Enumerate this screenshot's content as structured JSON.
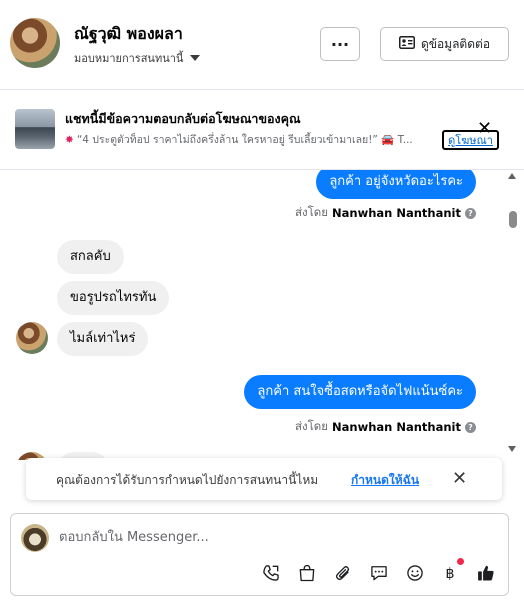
{
  "header": {
    "name": "ณัฐวุฒิ พองผลา",
    "assign_label": "มอบหมายการสนทนานี้",
    "more_label": "···",
    "contact_button": "ดูข้อมูลติดต่อ"
  },
  "ad": {
    "title": "แชทนี้มีข้อความตอบกลับต่อโฆษณาของคุณ",
    "snippet": "“4 ประตูตัวท็อป ราคาไม่ถึงครึ่งล้าน ใครหาอยู่ รีบเลี้ยวเข้ามาเลย!” 🚘 T...",
    "link_label": "ดูโฆษณา",
    "close_label": "✕"
  },
  "messages": {
    "out1": "ลูกค้า  อยู่จังหวัดอะไรคะ",
    "sent_prefix": "ส่งโดย",
    "sent_by_name": "Nanwhan Nanthanit",
    "in1": "สกลคับ",
    "in2": "ขอรูปรถไทรทัน",
    "in3": "ไมล์เท่าไหร่",
    "out2": "ลูกค้า สนใจซื้อสดหรือจัดไฟแน้นซ์คะ"
  },
  "prompt": {
    "text": "คุณต้องการได้รับการกำหนดไปยังการสนทนานี้ไหม",
    "link": "กำหนดให้ฉัน",
    "close": "✕"
  },
  "composer": {
    "placeholder": "ตอบกลับใน Messenger..."
  },
  "colors": {
    "accent": "#0a7cff",
    "link": "#1877f2",
    "incoming_bubble": "#f0f0f0",
    "notification_dot": "#f02849"
  },
  "icons": [
    "more-icon",
    "contact-card-icon",
    "close-icon",
    "info-icon",
    "phone-icon",
    "bag-icon",
    "paperclip-icon",
    "chat-icon",
    "emoji-icon",
    "baht-icon",
    "thumbs-up-icon"
  ]
}
